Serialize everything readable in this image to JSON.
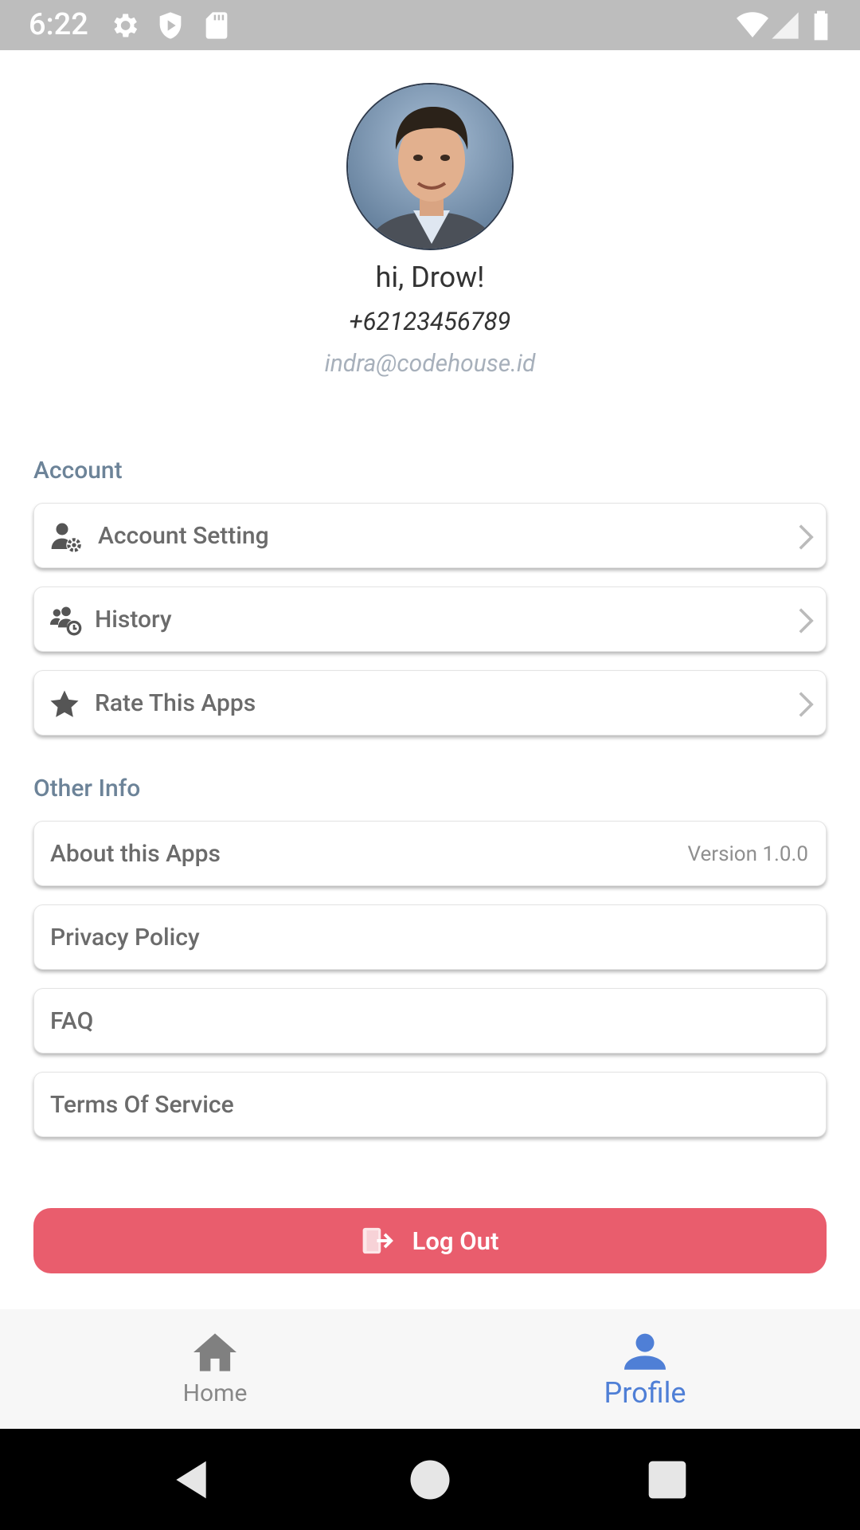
{
  "status_bar": {
    "time": "6:22",
    "left_icons": [
      "settings-icon",
      "shield-icon",
      "sd-card-icon"
    ],
    "right_icons": [
      "wifi-icon",
      "signal-icon",
      "battery-icon"
    ]
  },
  "profile": {
    "greeting": "hi, Drow!",
    "phone": "+62123456789",
    "email": "indra@codehouse.id"
  },
  "account_section": {
    "title": "Account",
    "items": [
      {
        "label": "Account Setting",
        "icon": "user-gear-icon"
      },
      {
        "label": "History",
        "icon": "user-clock-icon"
      },
      {
        "label": "Rate This Apps",
        "icon": "star-icon"
      }
    ]
  },
  "other_info_section": {
    "title": "Other Info",
    "items": [
      {
        "label": "About this Apps",
        "value": "Version 1.0.0"
      },
      {
        "label": "Privacy Policy"
      },
      {
        "label": "FAQ"
      },
      {
        "label": "Terms Of Service"
      }
    ]
  },
  "logout": {
    "label": "Log Out",
    "icon": "logout-icon"
  },
  "bottom_nav": {
    "items": [
      {
        "label": "Home",
        "icon": "home-icon",
        "active": false
      },
      {
        "label": "Profile",
        "icon": "person-icon",
        "active": true
      }
    ]
  },
  "colors": {
    "accent": "#4f7fd6",
    "logout": "#e95d6d",
    "section_title": "#6c8398",
    "status_bar": "#bdbdbd"
  }
}
